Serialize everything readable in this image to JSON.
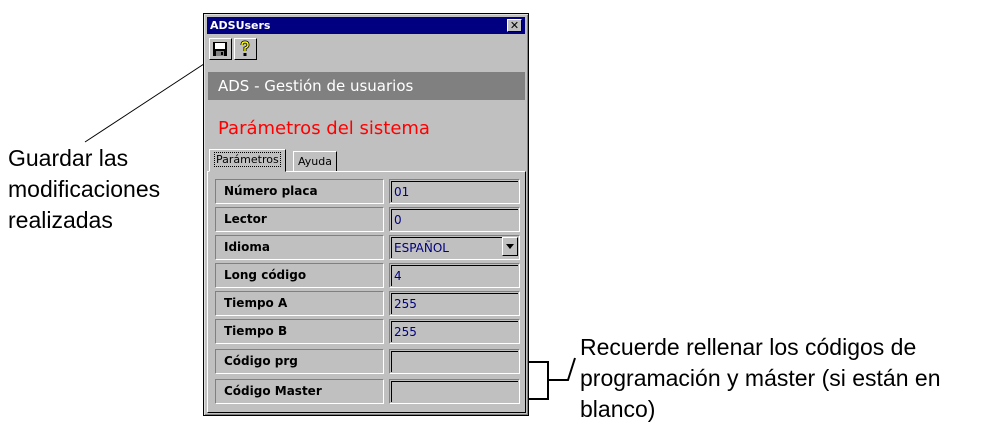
{
  "annotations": {
    "left": [
      "Guardar las",
      "modificaciones",
      "realizadas"
    ],
    "right": [
      "Recuerde rellenar los códigos de",
      "programación y máster (si están en",
      "blanco)"
    ]
  },
  "window": {
    "title": "ADSUsers",
    "close_glyph": "✕",
    "toolbar": {
      "icons": [
        "save-icon",
        "help-icon"
      ]
    },
    "header": "ADS - Gestión de usuarios",
    "section_title": "Parámetros del sistema",
    "section_title_color": "#ff0000",
    "tabs": [
      {
        "label": "Parámetros",
        "active": true
      },
      {
        "label": "Ayuda",
        "active": false
      }
    ],
    "fields": [
      {
        "label": "Número placa",
        "value": "01"
      },
      {
        "label": "Lector",
        "value": "0"
      },
      {
        "label": "Idioma",
        "value": "ESPAÑOL"
      },
      {
        "label": "Long código",
        "value": "4"
      },
      {
        "label": "Tiempo A",
        "value": "255"
      },
      {
        "label": "Tiempo B",
        "value": "255"
      },
      {
        "label": "Código prg",
        "value": ""
      },
      {
        "label": "Código Master",
        "value": ""
      }
    ]
  }
}
